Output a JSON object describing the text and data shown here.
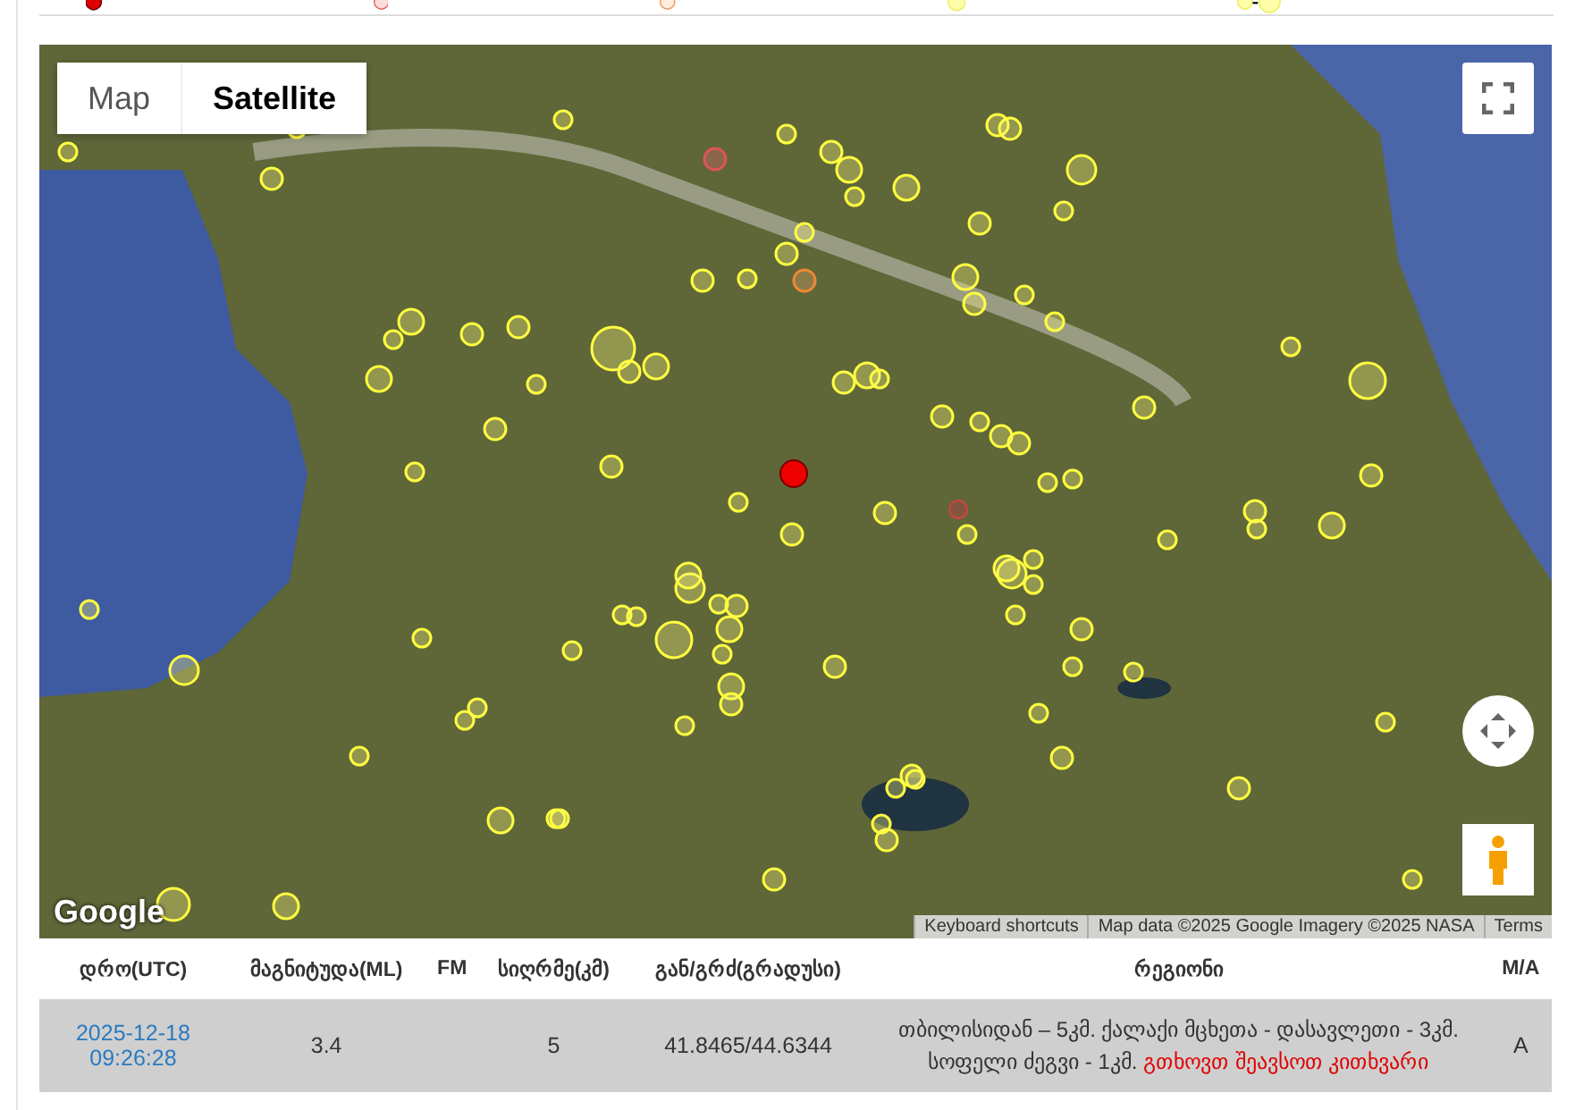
{
  "map": {
    "map_types": [
      {
        "label": "Map",
        "selected": false
      },
      {
        "label": "Satellite",
        "selected": true
      }
    ],
    "logo": "Google",
    "attribution": [
      "Keyboard shortcuts",
      "Map data ©2025 Google Imagery ©2025 NASA",
      "Terms"
    ]
  },
  "table": {
    "columns": [
      "დრო(UTC)",
      "მაგნიტუდა(ML)",
      "FM",
      "სიღრმე(კმ)",
      "გან/გრძ(გრადუსი)",
      "რეგიონი",
      "M/A"
    ],
    "rows": [
      {
        "selected": true,
        "time": "2025-12-18 09:26:28",
        "magnitude": "3.4",
        "fm": "",
        "depth": "5",
        "coords": "41.8465/44.6344",
        "region": "თბილისიდან – 5კმ. ქალაქი მცხეთა - დასავლეთი - 3კმ. სოფელი ძეგვი - 1კმ.",
        "region_link": "გთხოვთ შეავსოთ კითხვარი",
        "ma": "A"
      }
    ]
  }
}
